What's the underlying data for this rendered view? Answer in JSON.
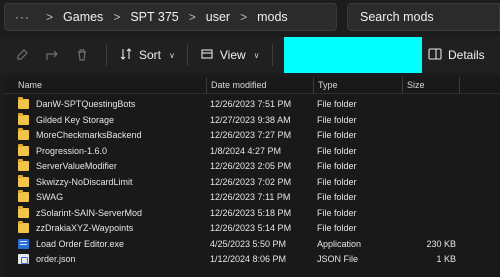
{
  "address": {
    "overflow": "···",
    "crumbs": [
      "Games",
      "SPT 375",
      "user",
      "mods"
    ],
    "separator": ">"
  },
  "search": {
    "placeholder": "Search mods"
  },
  "toolbar": {
    "sort_label": "Sort",
    "view_label": "View",
    "more_label": "···",
    "details_label": "Details"
  },
  "colors": {
    "highlight": "#00ffff",
    "folder": "#f2c447"
  },
  "columns": {
    "name": "Name",
    "date": "Date modified",
    "type": "Type",
    "size": "Size"
  },
  "files": [
    {
      "name": "DanW-SPTQuestingBots",
      "date": "12/26/2023 7:51 PM",
      "type": "File folder",
      "size": "",
      "icon": "folder-icon"
    },
    {
      "name": "Gilded Key Storage",
      "date": "12/27/2023 9:38 AM",
      "type": "File folder",
      "size": "",
      "icon": "folder-icon"
    },
    {
      "name": "MoreCheckmarksBackend",
      "date": "12/26/2023 7:27 PM",
      "type": "File folder",
      "size": "",
      "icon": "folder-icon"
    },
    {
      "name": "Progression-1.6.0",
      "date": "1/8/2024 4:27 PM",
      "type": "File folder",
      "size": "",
      "icon": "folder-icon"
    },
    {
      "name": "ServerValueModifier",
      "date": "12/26/2023 2:05 PM",
      "type": "File folder",
      "size": "",
      "icon": "folder-icon"
    },
    {
      "name": "Skwizzy-NoDiscardLimit",
      "date": "12/26/2023 7:02 PM",
      "type": "File folder",
      "size": "",
      "icon": "folder-icon"
    },
    {
      "name": "SWAG",
      "date": "12/26/2023 7:11 PM",
      "type": "File folder",
      "size": "",
      "icon": "folder-icon"
    },
    {
      "name": "zSolarint-SAIN-ServerMod",
      "date": "12/26/2023 5:18 PM",
      "type": "File folder",
      "size": "",
      "icon": "folder-icon"
    },
    {
      "name": "zzDrakiaXYZ-Waypoints",
      "date": "12/26/2023 5:14 PM",
      "type": "File folder",
      "size": "",
      "icon": "folder-icon"
    },
    {
      "name": "Load Order Editor.exe",
      "date": "4/25/2023 5:50 PM",
      "type": "Application",
      "size": "230 KB",
      "icon": "application-icon"
    },
    {
      "name": "order.json",
      "date": "1/12/2024 8:06 PM",
      "type": "JSON File",
      "size": "1 KB",
      "icon": "json-file-icon"
    }
  ]
}
